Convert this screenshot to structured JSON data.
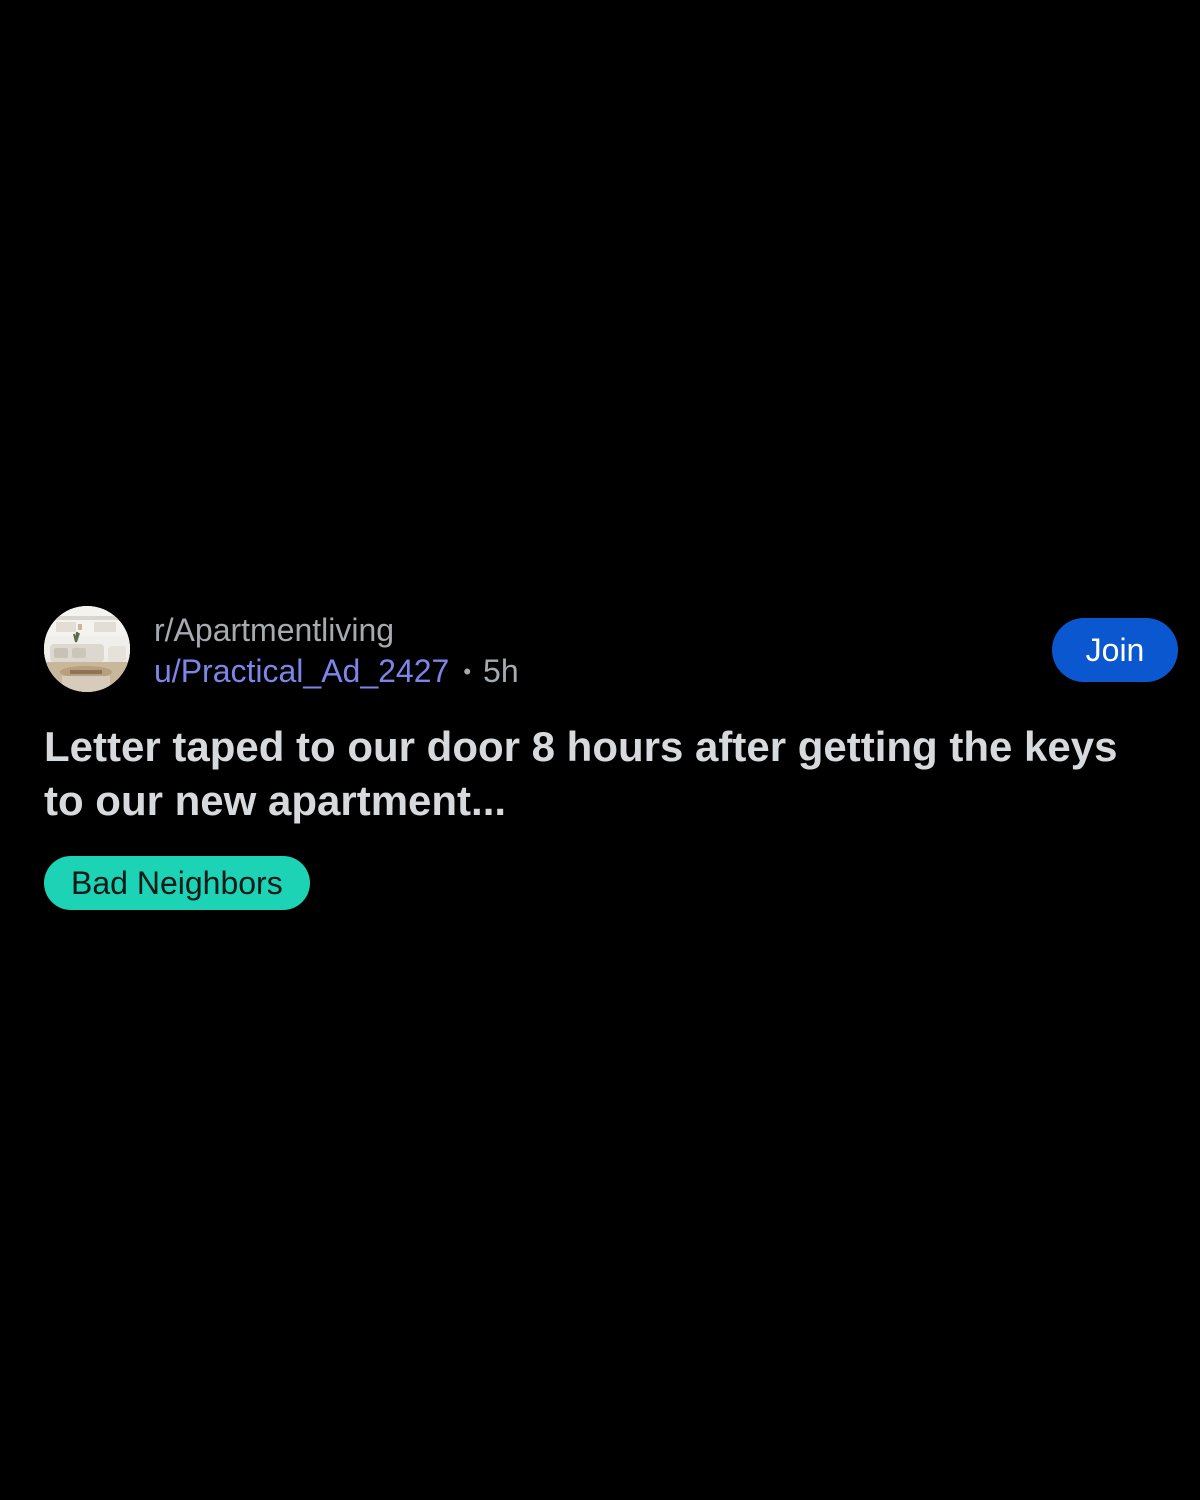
{
  "post": {
    "subreddit": "r/Apartmentliving",
    "username": "u/Practical_Ad_2427",
    "separator": "•",
    "age": "5h",
    "join_label": "Join",
    "title": "Letter taped to our door 8 hours after getting the keys to our new apartment...",
    "flair": "Bad Neighbors",
    "avatar_icon": "subreddit-avatar-living-room"
  },
  "colors": {
    "background": "#000000",
    "join_button": "#0b57d0",
    "flair": "#1dd3b5",
    "username": "#7b86e8"
  }
}
